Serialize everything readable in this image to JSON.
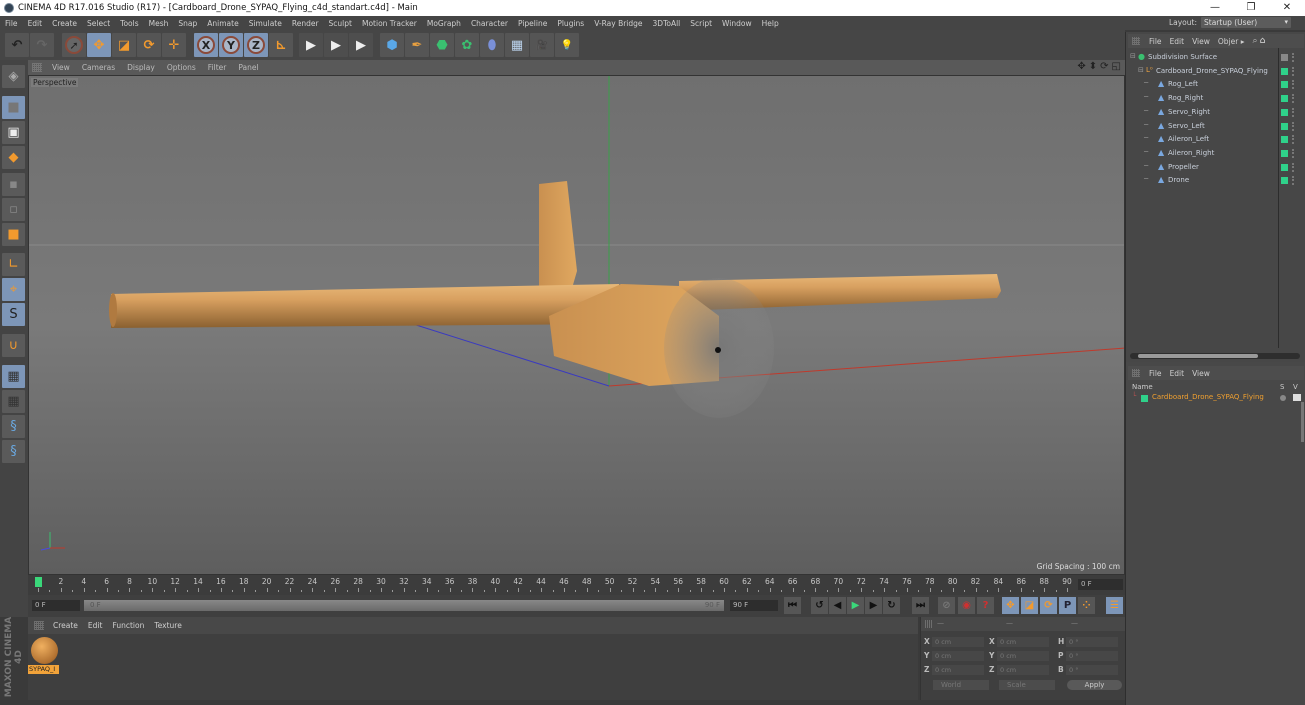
{
  "window": {
    "title": "CINEMA 4D R17.016 Studio (R17) - [Cardboard_Drone_SYPAQ_Flying_c4d_standart.c4d] - Main",
    "controls": [
      "—",
      "❐",
      "✕"
    ]
  },
  "menubar": {
    "items": [
      "File",
      "Edit",
      "Create",
      "Select",
      "Tools",
      "Mesh",
      "Snap",
      "Animate",
      "Simulate",
      "Render",
      "Sculpt",
      "Motion Tracker",
      "MoGraph",
      "Character",
      "Pipeline",
      "Plugins",
      "V-Ray Bridge",
      "3DToAll",
      "Script",
      "Window",
      "Help"
    ],
    "layout_label": "Layout:",
    "layout_value": "Startup (User)"
  },
  "toolbar": {
    "tools": [
      {
        "name": "undo-icon",
        "glyph": "↶"
      },
      {
        "name": "redo-icon",
        "glyph": "↷"
      },
      {
        "name": "live-selection-icon",
        "glyph": "➚"
      },
      {
        "name": "move-icon",
        "glyph": "✥"
      },
      {
        "name": "scale-icon",
        "glyph": "◪"
      },
      {
        "name": "rotate-icon",
        "glyph": "⟳"
      },
      {
        "name": "recent-tools-icon",
        "glyph": "✛"
      },
      {
        "name": "x-axis-lock-icon",
        "glyph": "X"
      },
      {
        "name": "y-axis-lock-icon",
        "glyph": "Y"
      },
      {
        "name": "z-axis-lock-icon",
        "glyph": "Z"
      },
      {
        "name": "coordinate-system-icon",
        "glyph": "⊾"
      },
      {
        "name": "render-view-icon",
        "glyph": "▶"
      },
      {
        "name": "render-picture-viewer-icon",
        "glyph": "▶"
      },
      {
        "name": "render-settings-icon",
        "glyph": "▶"
      },
      {
        "name": "cube-icon",
        "glyph": "⬢"
      },
      {
        "name": "pen-spline-icon",
        "glyph": "✒"
      },
      {
        "name": "subdivision-surface-icon",
        "glyph": "⬣"
      },
      {
        "name": "cloner-icon",
        "glyph": "✿"
      },
      {
        "name": "deformer-icon",
        "glyph": "⬮"
      },
      {
        "name": "floor-icon",
        "glyph": "▦"
      },
      {
        "name": "camera-icon",
        "glyph": "🎥"
      },
      {
        "name": "light-icon",
        "glyph": "💡"
      }
    ]
  },
  "left_toolbar": {
    "tools": [
      {
        "name": "make-editable-icon",
        "glyph": "◈"
      },
      {
        "name": "model-mode-icon",
        "glyph": "■"
      },
      {
        "name": "texture-mode-icon",
        "glyph": "▣"
      },
      {
        "name": "workplane-icon",
        "glyph": "◆"
      },
      {
        "name": "points-mode-icon",
        "glyph": "▪"
      },
      {
        "name": "edges-mode-icon",
        "glyph": "▫"
      },
      {
        "name": "polygons-mode-icon",
        "glyph": "■"
      },
      {
        "name": "axis-mode-icon",
        "glyph": "∟"
      },
      {
        "name": "tweak-mode-icon",
        "glyph": "⌖"
      },
      {
        "name": "snap-icon",
        "glyph": "S"
      },
      {
        "name": "magnet-icon",
        "glyph": "∪"
      },
      {
        "name": "locked-workplane-icon",
        "glyph": "▦"
      },
      {
        "name": "planar-workplane-icon",
        "glyph": "▦"
      },
      {
        "name": "python-icon",
        "glyph": "§"
      },
      {
        "name": "python-script-icon",
        "glyph": "§"
      }
    ]
  },
  "viewport": {
    "menu": [
      "View",
      "Cameras",
      "Display",
      "Options",
      "Filter",
      "Panel"
    ],
    "label": "Perspective",
    "grid_spacing": "Grid Spacing : 100 cm",
    "nav_icons": [
      "✥",
      "⬍",
      "⟳",
      "◱"
    ]
  },
  "timeline": {
    "ticks": [
      0,
      2,
      4,
      6,
      8,
      10,
      12,
      14,
      16,
      18,
      20,
      22,
      24,
      26,
      28,
      30,
      32,
      34,
      36,
      38,
      40,
      42,
      44,
      46,
      48,
      50,
      52,
      54,
      56,
      58,
      60,
      62,
      64,
      66,
      68,
      70,
      72,
      74,
      76,
      78,
      80,
      82,
      84,
      86,
      88,
      90
    ],
    "max_frame": 90,
    "current_frame": 0,
    "frame_field": "0 F"
  },
  "transport": {
    "start_field": "0 F",
    "slider_start": "0 F",
    "slider_end": "90 F",
    "end_field": "90 F",
    "buttons": [
      {
        "name": "go-to-start-button",
        "glyph": "⏮"
      },
      {
        "name": "go-to-prev-key-button",
        "glyph": "↺"
      },
      {
        "name": "prev-frame-button",
        "glyph": "◀"
      },
      {
        "name": "play-button",
        "glyph": "▶"
      },
      {
        "name": "next-frame-button",
        "glyph": "▶"
      },
      {
        "name": "loop-button",
        "glyph": "↻"
      },
      {
        "name": "go-to-end-button",
        "glyph": "⏭"
      },
      {
        "name": "record-keys-disabled-button",
        "glyph": "⊘"
      },
      {
        "name": "record-active-objects-button",
        "glyph": "◉"
      },
      {
        "name": "autokeying-button",
        "glyph": "?"
      },
      {
        "name": "key-position-button",
        "glyph": "✥"
      },
      {
        "name": "key-scale-button",
        "glyph": "◪"
      },
      {
        "name": "key-rotation-button",
        "glyph": "⟳"
      },
      {
        "name": "key-parameter-button",
        "glyph": "P"
      },
      {
        "name": "key-pla-button",
        "glyph": "⁘"
      },
      {
        "name": "timeline-layout-button",
        "glyph": "☰"
      }
    ]
  },
  "materials": {
    "menu": [
      "Create",
      "Edit",
      "Function",
      "Texture"
    ],
    "items": [
      {
        "label": "SYPAQ_I",
        "color": "#c8843c"
      }
    ],
    "brand": "MAXON CINEMA 4D"
  },
  "coordinates": {
    "headers": [
      "—",
      "—",
      "—"
    ],
    "rows": [
      {
        "l1": "X",
        "v1": "0 cm",
        "l2": "X",
        "v2": "0 cm",
        "l3": "H",
        "v3": "0 °"
      },
      {
        "l1": "Y",
        "v1": "0 cm",
        "l2": "Y",
        "v2": "0 cm",
        "l3": "P",
        "v3": "0 °"
      },
      {
        "l1": "Z",
        "v1": "0 cm",
        "l2": "Z",
        "v2": "0 cm",
        "l3": "B",
        "v3": "0 °"
      }
    ],
    "space_select": "World",
    "mode_select": "Scale",
    "apply_label": "Apply"
  },
  "object_manager": {
    "menu": [
      "File",
      "Edit",
      "View",
      "Objer ▸"
    ],
    "objects": [
      {
        "name": "Subdivision Surface",
        "depth": 0,
        "icon": "subdivision-icon",
        "glyph": "●"
      },
      {
        "name": "Cardboard_Drone_SYPAQ_Flying",
        "depth": 1,
        "icon": "null-object-icon",
        "glyph": "L⁰"
      },
      {
        "name": "Rog_Left",
        "depth": 2,
        "icon": "polygon-object-icon",
        "glyph": "▲"
      },
      {
        "name": "Rog_Right",
        "depth": 2,
        "icon": "polygon-object-icon",
        "glyph": "▲"
      },
      {
        "name": "Servo_Right",
        "depth": 2,
        "icon": "polygon-object-icon",
        "glyph": "▲"
      },
      {
        "name": "Servo_Left",
        "depth": 2,
        "icon": "polygon-object-icon",
        "glyph": "▲"
      },
      {
        "name": "Aileron_Left",
        "depth": 2,
        "icon": "polygon-object-icon",
        "glyph": "▲"
      },
      {
        "name": "Aileron_Right",
        "depth": 2,
        "icon": "polygon-object-icon",
        "glyph": "▲"
      },
      {
        "name": "Propeller",
        "depth": 2,
        "icon": "polygon-object-icon",
        "glyph": "▲"
      },
      {
        "name": "Drone",
        "depth": 2,
        "icon": "polygon-object-icon",
        "glyph": "▲"
      }
    ]
  },
  "layers_panel": {
    "menu": [
      "File",
      "Edit",
      "View"
    ],
    "columns": {
      "name": "Name",
      "s": "S",
      "v": "V"
    },
    "layers": [
      {
        "name": "Cardboard_Drone_SYPAQ_Flying",
        "color": "#2fd18a"
      }
    ]
  },
  "colors": {
    "accent_blue": "#7d96b8",
    "layer_green": "#2fd18a",
    "material_orange": "#f2a33a",
    "axis_x": "#c0392b",
    "axis_y": "#3aa04a",
    "axis_z": "#3a3ac0"
  }
}
